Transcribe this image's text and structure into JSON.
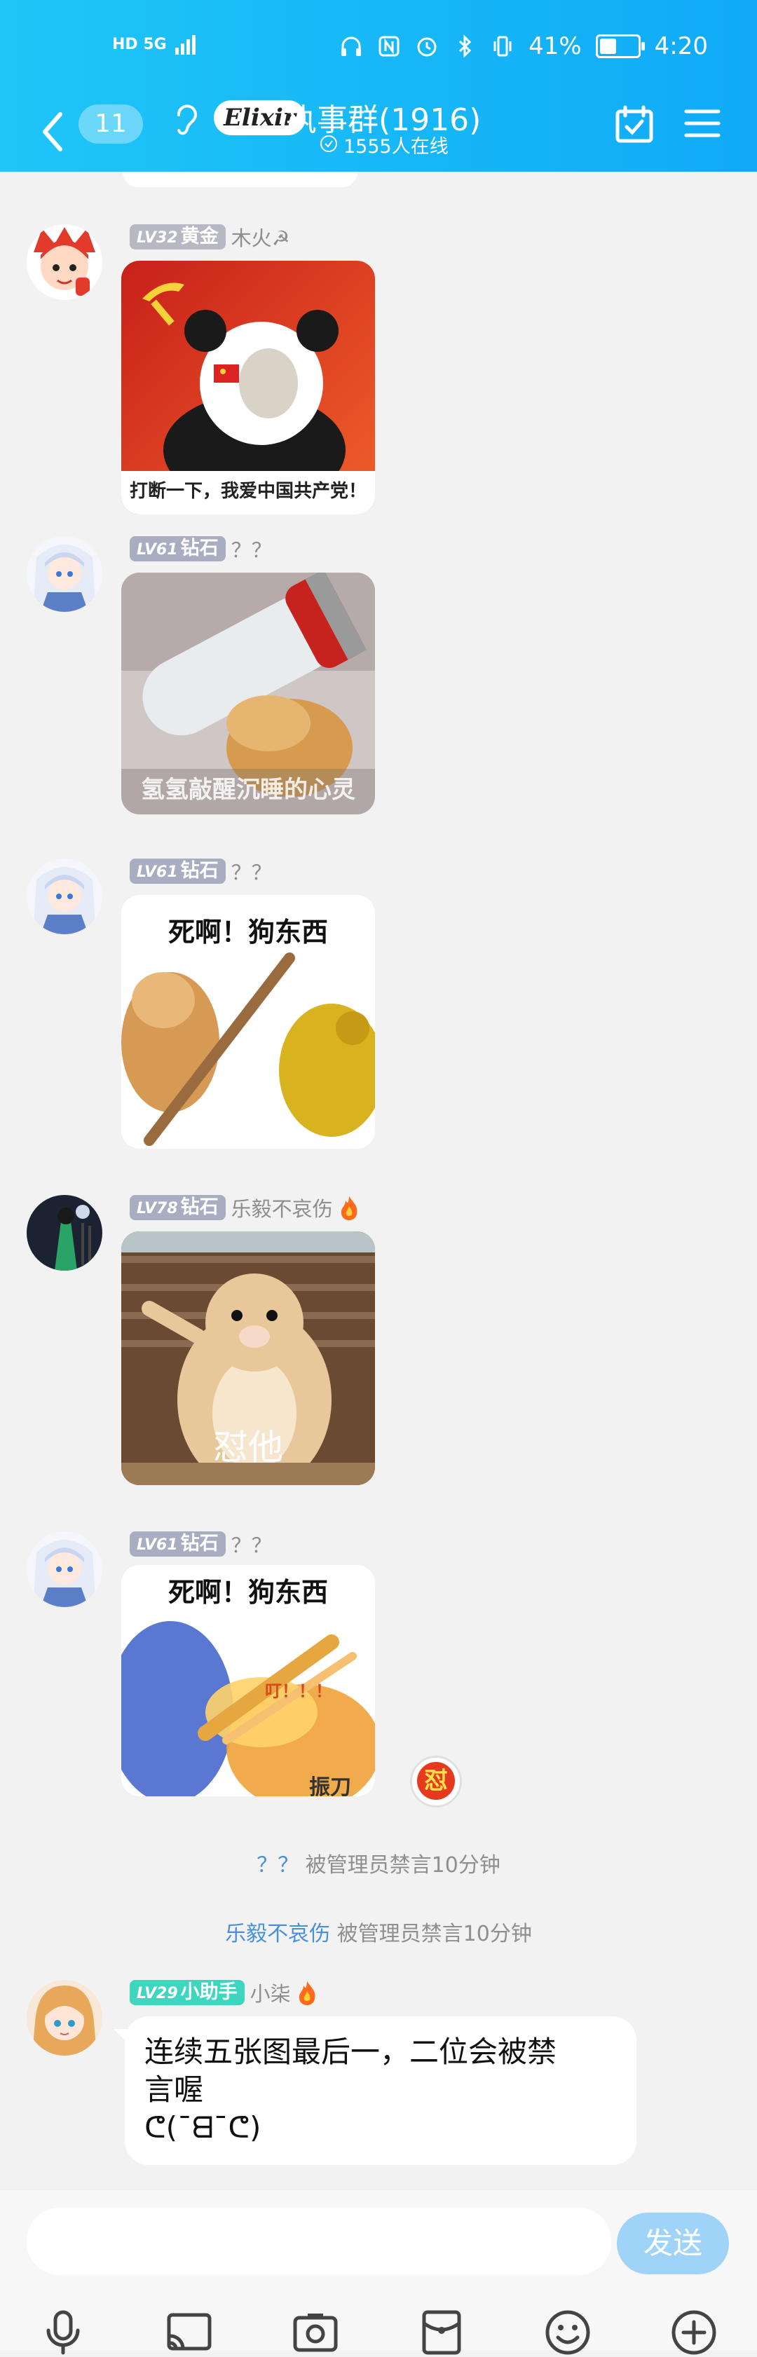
{
  "status_bar": {
    "network": "HD 5G",
    "battery": "41%",
    "time": "4:20"
  },
  "header": {
    "back_count": "11",
    "logo_text": "Elixir",
    "title": "执事群(1916)",
    "online": "1555人在线"
  },
  "messages": [
    {
      "level": "LV32",
      "rank": "黄金",
      "nick": "木火☭",
      "sticker_caption": "打断一下，我爱中国共产党！"
    },
    {
      "level": "LV61",
      "rank": "钻石",
      "nick": "？？",
      "sticker_caption": "氢氢敲醒沉睡的心灵"
    },
    {
      "level": "LV61",
      "rank": "钻石",
      "nick": "？？",
      "sticker_caption": "死啊！狗东西"
    },
    {
      "level": "LV78",
      "rank": "钻石",
      "nick": "乐毅不哀伤",
      "sticker_caption": "怼他"
    },
    {
      "level": "LV61",
      "rank": "钻石",
      "nick": "？？",
      "sticker_caption": "死啊！狗东西",
      "sticker_caption2": "叮！！！",
      "sticker_caption3": "振刀",
      "reaction_badge": "怼"
    }
  ],
  "system_notices": [
    {
      "who": "？？",
      "text": "被管理员禁言10分钟"
    },
    {
      "who": "乐毅不哀伤",
      "text": "被管理员禁言10分钟"
    }
  ],
  "bot_message": {
    "level": "LV29",
    "rank": "小助手",
    "nick": "小柒",
    "line1": "连续五张图最后一，二位会被禁",
    "line2": "言喔",
    "line3": "ᕦ(¯ᗺ¯ᕦ)"
  },
  "input": {
    "placeholder": "",
    "send_label": "发送"
  },
  "colors": {
    "header": "#10aaf7",
    "gold_badge": "#b8b8c4",
    "diamond_badge": "#a8adc2",
    "assistant_badge": "#3fd6c0",
    "send": "#9fd4f8"
  }
}
